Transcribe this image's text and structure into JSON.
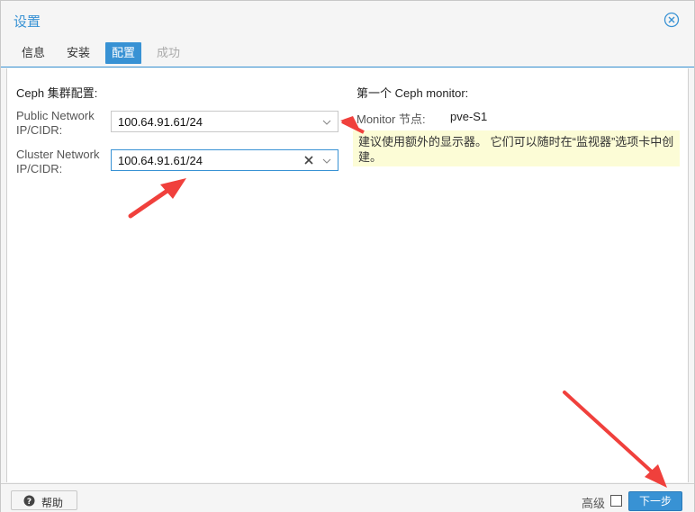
{
  "window": {
    "title": "设置"
  },
  "tabs": [
    {
      "label": "信息"
    },
    {
      "label": "安装"
    },
    {
      "label": "配置"
    },
    {
      "label": "成功"
    }
  ],
  "config": {
    "section_title": "Ceph 集群配置:",
    "public_network": {
      "label_line1": "Public Network",
      "label_line2": "IP/CIDR:",
      "value": "100.64.91.61/24"
    },
    "cluster_network": {
      "label_line1": "Cluster Network",
      "label_line2": "IP/CIDR:",
      "value": "100.64.91.61/24"
    }
  },
  "monitor": {
    "section_title": "第一个 Ceph monitor:",
    "node_label": "Monitor 节点:",
    "node_value": "pve-S1",
    "hint_line1": "建议使用额外的显示器。 它们可以随时在“监视器”选项卡中创",
    "hint_line2": "建。"
  },
  "footer": {
    "help_label": "帮助",
    "advanced_label": "高级",
    "next_label": "下一步"
  },
  "colors": {
    "accent": "#3892d4",
    "hint_bg": "#fcfcd6",
    "annotation_arrow": "#f0403c"
  }
}
